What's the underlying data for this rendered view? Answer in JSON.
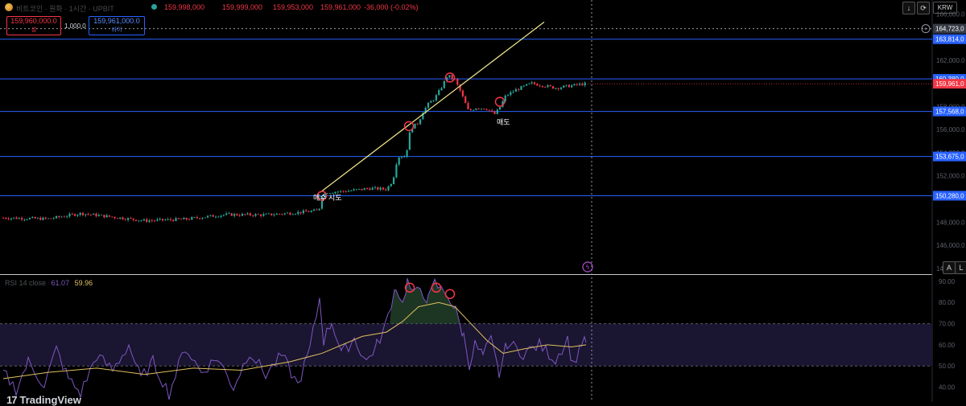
{
  "header": {
    "symbol_text": "비트코인 · 원화 · 1시간 · UPBIT",
    "open": "159,998,000",
    "high": "159,999,000",
    "low": "159,953,000",
    "close": "159,961,000",
    "change": "-36,000 (-0.02%)",
    "sell_price": "159,960,000.0",
    "sell_label": "셀",
    "spread": "1,000.0",
    "buy_price": "159,961,000.0",
    "buy_label": "바이"
  },
  "toolbar": {
    "currency": "KRW",
    "download_icon": "↓",
    "replay_icon": "⟳",
    "auto_label": "A",
    "log_label": "L"
  },
  "chart_data": {
    "type": "candlestick",
    "price_axis_ticks": [
      "166,000.0",
      "164,000.0",
      "162,000.0",
      "158,000.0",
      "156,000.0",
      "154,000.0",
      "152,000.0",
      "148,000.0",
      "146,000.0",
      "144,000.0"
    ],
    "ylim": [
      143500,
      167200
    ],
    "horizontal_levels": [
      163814,
      160380,
      157568,
      153675,
      150280
    ],
    "level_labels": [
      "163,814,0",
      "160,380,0",
      "157,568,0",
      "153,675,0",
      "150,280,0"
    ],
    "current_price_label": "159,961,0",
    "crosshair_label": "164,723,0",
    "annotations": {
      "buy_attempt": "매수 시도",
      "sell": "매도"
    },
    "rsi_legend": {
      "name": "RSI 14 close",
      "rsi_value": "61.07",
      "ma_value": "59.96"
    },
    "rsi_axis_ticks": [
      "90.00",
      "80.00",
      "70.00",
      "60.00",
      "50.00",
      "40.00"
    ],
    "rsi_ylim": [
      33,
      93
    ],
    "rsi_band": [
      70,
      50
    ]
  },
  "footer": {
    "brand": "TradingView"
  },
  "colors": {
    "up": "#26a69a",
    "down": "#f23645",
    "level": "#2962ff",
    "trend": "#f0e68c",
    "rsi": "#7e57c2",
    "rsi_ma": "#e0c060"
  }
}
